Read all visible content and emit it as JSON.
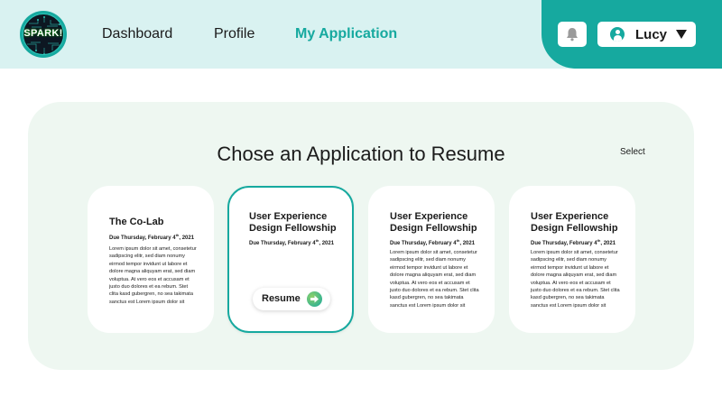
{
  "brand": {
    "logo_text": "SPARK!"
  },
  "nav": {
    "items": [
      {
        "label": "Dashboard"
      },
      {
        "label": "Profile"
      },
      {
        "label": "My Application",
        "active": true
      }
    ]
  },
  "header": {
    "notifications_icon": "bell-icon",
    "user": {
      "name": "Lucy",
      "avatar_icon": "user-icon",
      "dropdown_icon": "caret-down-icon"
    }
  },
  "main": {
    "title": "Chose an Application to Resume",
    "select_label": "Select",
    "cards": [
      {
        "title": "The Co-Lab",
        "due": "Due Thursday, February 4",
        "due_sup": "th",
        "due_year": ", 2021",
        "body": "Lorem ipsum dolor sit amet, consetetur sadipscing elitr, sed diam nonumy eirmod tempor invidunt ut labore et dolore magna aliquyam erat, sed diam voluptua. At vero eos et accusam et justo duo dolores et ea rebum. Stet clita kasd gubergren, no sea takimata sanctus est Lorem ipsum dolor sit"
      },
      {
        "title": "User Experience Design Fellowship",
        "due": "Due Thursday, February 4",
        "due_sup": "th",
        "due_year": ", 2021",
        "selected": true,
        "resume_label": "Resume",
        "resume_icon": "arrow-right-icon"
      },
      {
        "title": "User Experience Design Fellowship",
        "due": "Due Thursday, February 4",
        "due_sup": "th",
        "due_year": ", 2021",
        "body": "Lorem ipsum dolor sit amet, consetetur sadipscing elitr, sed diam nonumy eirmod tempor invidunt ut labore et dolore magna aliquyam erat, sed diam voluptua. At vero eos et accusam et justo duo dolores et ea rebum. Stet clita kasd gubergren, no sea takimata sanctus est Lorem ipsum dolor sit"
      },
      {
        "title": "User Experience Design Fellowship",
        "due": "Due Thursday, February 4",
        "due_sup": "th",
        "due_year": ", 2021",
        "body": "Lorem ipsum dolor sit amet, consetetur sadipscing elitr, sed diam nonumy eirmod tempor invidunt ut labore et dolore magna aliquyam erat, sed diam voluptua. At vero eos et accusam et justo duo dolores et ea rebum. Stet clita kasd gubergren, no sea takimata sanctus est Lorem ipsum dolor sit"
      }
    ]
  },
  "colors": {
    "accent": "#16a99f",
    "header_bg": "#d9f2f1",
    "panel_bg": "#eef7f1",
    "card_bg": "#ffffff",
    "text": "#1b1b1b"
  }
}
